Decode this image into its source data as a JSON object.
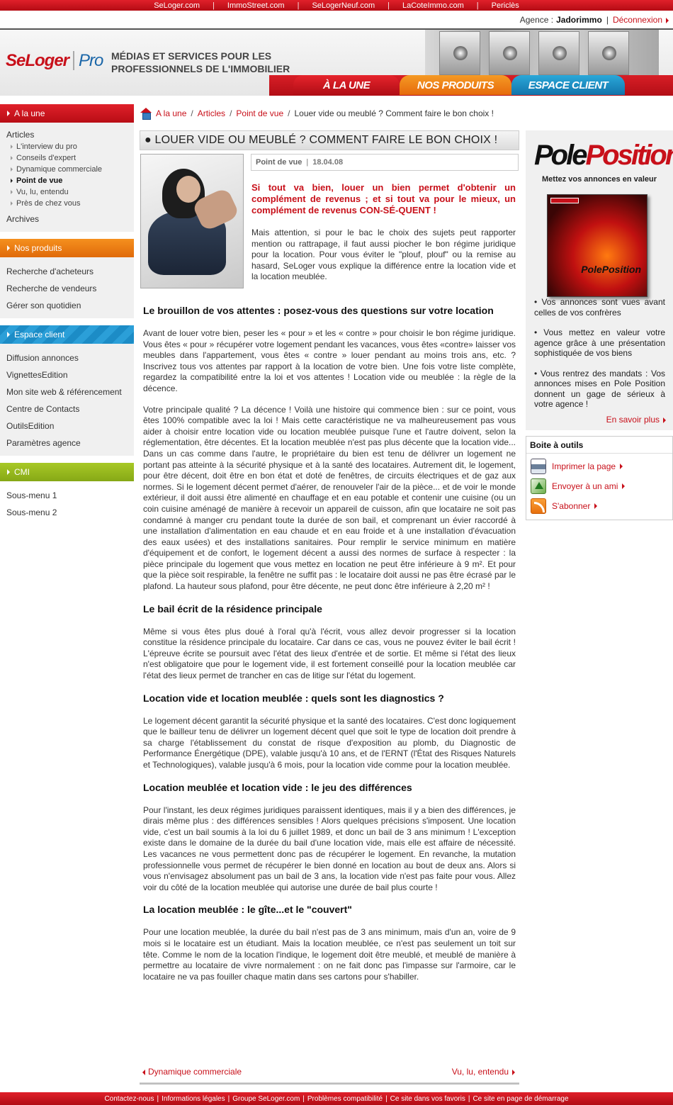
{
  "topbar": {
    "links": [
      "SeLoger.com",
      "ImmoStreet.com",
      "SeLogerNeuf.com",
      "LaCoteImmo.com",
      "Periclès"
    ]
  },
  "account": {
    "label": "Agence :",
    "name": "Jadorimmo",
    "logout": "Déconnexion"
  },
  "header": {
    "logo_main": "SeLoger",
    "logo_pro": "Pro",
    "tagline_1": "Médias et services pour les",
    "tagline_2": "professionnels de l'immobilier",
    "tabs": [
      "À la une",
      "Nos produits",
      "Espace client"
    ]
  },
  "sidebar": {
    "sections": [
      {
        "title": "A la une",
        "items": [
          "Articles",
          "Archives"
        ],
        "subitems": [
          "L'interview du pro",
          "Conseils d'expert",
          "Dynamique commerciale",
          "Point de vue",
          "Vu, lu, entendu",
          "Près de chez vous"
        ]
      },
      {
        "title": "Nos produits",
        "items": [
          "Recherche d'acheteurs",
          "Recherche de vendeurs",
          "Gérer son quotidien"
        ]
      },
      {
        "title": "Espace client",
        "items": [
          "Diffusion annonces",
          "VignettesEdition",
          "Mon site web & référencement",
          "Centre de Contacts",
          "OutilsEdition",
          "Paramètres agence"
        ]
      },
      {
        "title": "CMI",
        "items": [
          "Sous-menu 1",
          "Sous-menu 2"
        ]
      }
    ]
  },
  "breadcrumb": {
    "items": [
      "A la une",
      "Articles",
      "Point de vue"
    ],
    "current": "Louer vide ou meublé ? Comment faire le bon choix !"
  },
  "article": {
    "title": "● Louer vide ou meublé ? Comment faire le bon choix !",
    "category": "Point de vue",
    "date": "18.04.08",
    "intro": "Si tout va bien, louer un bien permet d'obtenir un complément de revenus ; et si tout va pour le mieux, un complément de revenus CON-SÉ-QUENT !",
    "intro_body": "Mais attention, si pour le bac le choix des sujets peut rapporter mention ou rattrapage, il faut aussi piocher le bon régime juridique pour la location. Pour vous éviter le \"plouf, plouf\" ou la remise au hasard, SeLoger vous explique la différence entre la location vide et la location meublée.",
    "sections": [
      {
        "heading": "Le brouillon de vos attentes : posez-vous des questions sur votre location",
        "paragraphs": [
          "Avant de louer votre bien, peser les « pour » et les « contre » pour choisir le bon régime juridique. Vous êtes « pour » récupérer votre logement pendant les vacances, vous êtes «contre» laisser vos meubles dans l'appartement, vous êtes « contre » louer pendant au moins trois ans, etc. ? Inscrivez tous vos attentes par rapport à la location de votre bien. Une fois votre liste complète, regardez la compatibilité entre la loi et vos attentes ! Location vide ou meublée : la règle de la décence.",
          "Votre principale qualité ? La décence ! Voilà une histoire qui commence bien : sur ce point, vous êtes 100% compatible avec la loi ! Mais cette caractéristique ne va malheureusement pas vous aider à choisir entre location vide ou location meublée puisque l'une et l'autre doivent, selon la réglementation, être décentes. Et la location meublée n'est pas plus décente que la location vide... Dans un cas comme dans l'autre, le propriétaire du bien est tenu de délivrer un logement ne portant pas atteinte à la sécurité physique et à la santé des locataires. Autrement dit, le logement, pour être décent, doit être en bon état et doté de fenêtres, de circuits électriques et de gaz aux normes. Si le logement décent permet d'aérer, de renouveler l'air de la pièce... et de voir le monde extérieur, il doit aussi être alimenté en chauffage et en eau potable et contenir une cuisine (ou un coin cuisine aménagé de manière à recevoir un appareil de cuisson, afin que locataire ne soit pas condamné à manger cru pendant toute la durée de son bail, et comprenant un évier raccordé à une installation d'alimentation en eau chaude et en eau froide et à une installation d'évacuation des eaux usées) et des installations sanitaires. Pour remplir le service minimum en matière d'équipement et de confort, le logement décent a aussi des normes de surface à respecter : la pièce principale du logement que vous mettez en location ne peut être inférieure à 9 m². Et pour que la pièce soit respirable, la fenêtre ne suffit pas : le locataire doit aussi ne pas être écrasé par le plafond. La hauteur sous plafond, pour être décente, ne peut donc être inférieure à 2,20 m² !"
        ]
      },
      {
        "heading": "Le bail écrit de la résidence principale",
        "paragraphs": [
          "Même si vous êtes plus doué à l'oral qu'à l'écrit, vous allez devoir progresser si la location constitue la résidence principale du locataire. Car dans ce cas, vous ne pouvez éviter le bail écrit ! L'épreuve écrite se poursuit avec l'état des lieux d'entrée et de sortie. Et même si l'état des lieux n'est obligatoire que pour le logement vide, il est fortement conseillé pour la location meublée car l'état des lieux permet de trancher en cas de litige sur l'état du logement."
        ]
      },
      {
        "heading": "Location vide et location meublée : quels sont les diagnostics ?",
        "paragraphs": [
          "Le logement décent garantit la sécurité physique et la santé des locataires. C'est donc logiquement que le bailleur tenu de délivrer un logement décent quel que soit le type de location doit prendre à sa charge l'établissement du constat de risque d'exposition au plomb, du Diagnostic de Performance Énergétique (DPE), valable jusqu'à 10 ans, et de l'ERNT (l'État des Risques Naturels et Technologiques), valable jusqu'à 6 mois, pour la location vide comme pour la location meublée."
        ]
      },
      {
        "heading": "Location meublée et location vide : le jeu des différences",
        "paragraphs": [
          "Pour l'instant, les deux régimes juridiques paraissent identiques, mais il y a bien des différences, je dirais même plus : des différences sensibles ! Alors quelques précisions s'imposent. Une location vide, c'est un bail soumis à la loi du 6 juillet 1989, et donc un bail de 3 ans minimum ! L'exception existe dans le domaine de la durée du bail d'une location vide, mais elle est affaire de nécessité. Les vacances ne vous permettent donc pas de récupérer le logement. En revanche, la mutation professionnelle vous permet de récupérer le bien donné en location au bout de deux ans. Alors si vous n'envisagez absolument pas un bail de 3 ans, la location vide n'est pas faite pour vous. Allez voir du côté de la location meublée qui autorise une durée de bail plus courte !"
        ]
      },
      {
        "heading": "La location meublée : le gîte...et le \"couvert\"",
        "paragraphs": [
          "Pour une location meublée, la durée du bail n'est pas de 3 ans minimum, mais d'un an, voire de 9 mois si le locataire est un étudiant. Mais la location meublée, ce n'est pas seulement un toit sur tête. Comme le nom de la location l'indique, le logement doit être meublé, et meublé de manière à permettre au locataire de vivre normalement : on ne fait donc pas l'impasse sur l'armoire, car le locataire ne va pas fouiller chaque matin dans ses cartons pour s'habiller."
        ]
      }
    ],
    "prev": "Dynamique commerciale",
    "next": "Vu, lu, entendu"
  },
  "promo": {
    "logo_1": "Pole",
    "logo_2": "Position",
    "subtitle": "Mettez vos annonces en valeur",
    "box_label": "PolePosition",
    "bullets": [
      "• Vos annonces sont vues avant celles de vos confrères",
      "• Vous mettez en valeur votre agence grâce à une présentation sophistiquée de vos biens",
      "• Vous rentrez des mandats : Vos annonces mises en Pole Position donnent un gage de sérieux à votre agence !"
    ],
    "more": "En savoir plus"
  },
  "tools": {
    "title": "Boite à outils",
    "items": [
      {
        "label": "Imprimer la page",
        "icon": "printer-icon"
      },
      {
        "label": "Envoyer à un ami",
        "icon": "send-icon"
      },
      {
        "label": "S'abonner",
        "icon": "rss-icon"
      }
    ]
  },
  "footer": {
    "links": [
      "Contactez-nous",
      "Informations légales",
      "Groupe SeLoger.com",
      "Problèmes compatibilité",
      "Ce site dans vos favoris",
      "Ce site en page de démarrage"
    ]
  },
  "colors": {
    "brand_red": "#c8101a",
    "orange": "#f08a1e",
    "blue": "#1c8cc6",
    "green": "#9aba1e"
  }
}
